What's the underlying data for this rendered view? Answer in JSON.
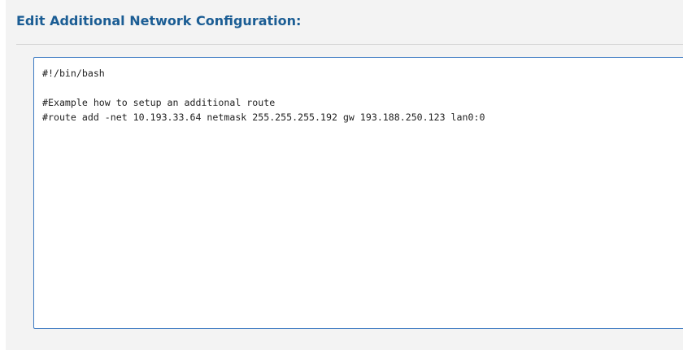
{
  "panel": {
    "title": "Edit Additional Network Configuration:"
  },
  "editor": {
    "content": "#!/bin/bash\n\n#Example how to setup an additional route\n#route add -net 10.193.33.64 netmask 255.255.255.192 gw 193.188.250.123 lan0:0"
  },
  "colors": {
    "title": "#1b5d94",
    "editor_border": "#3c7ac2",
    "panel_background": "#f3f3f3"
  }
}
